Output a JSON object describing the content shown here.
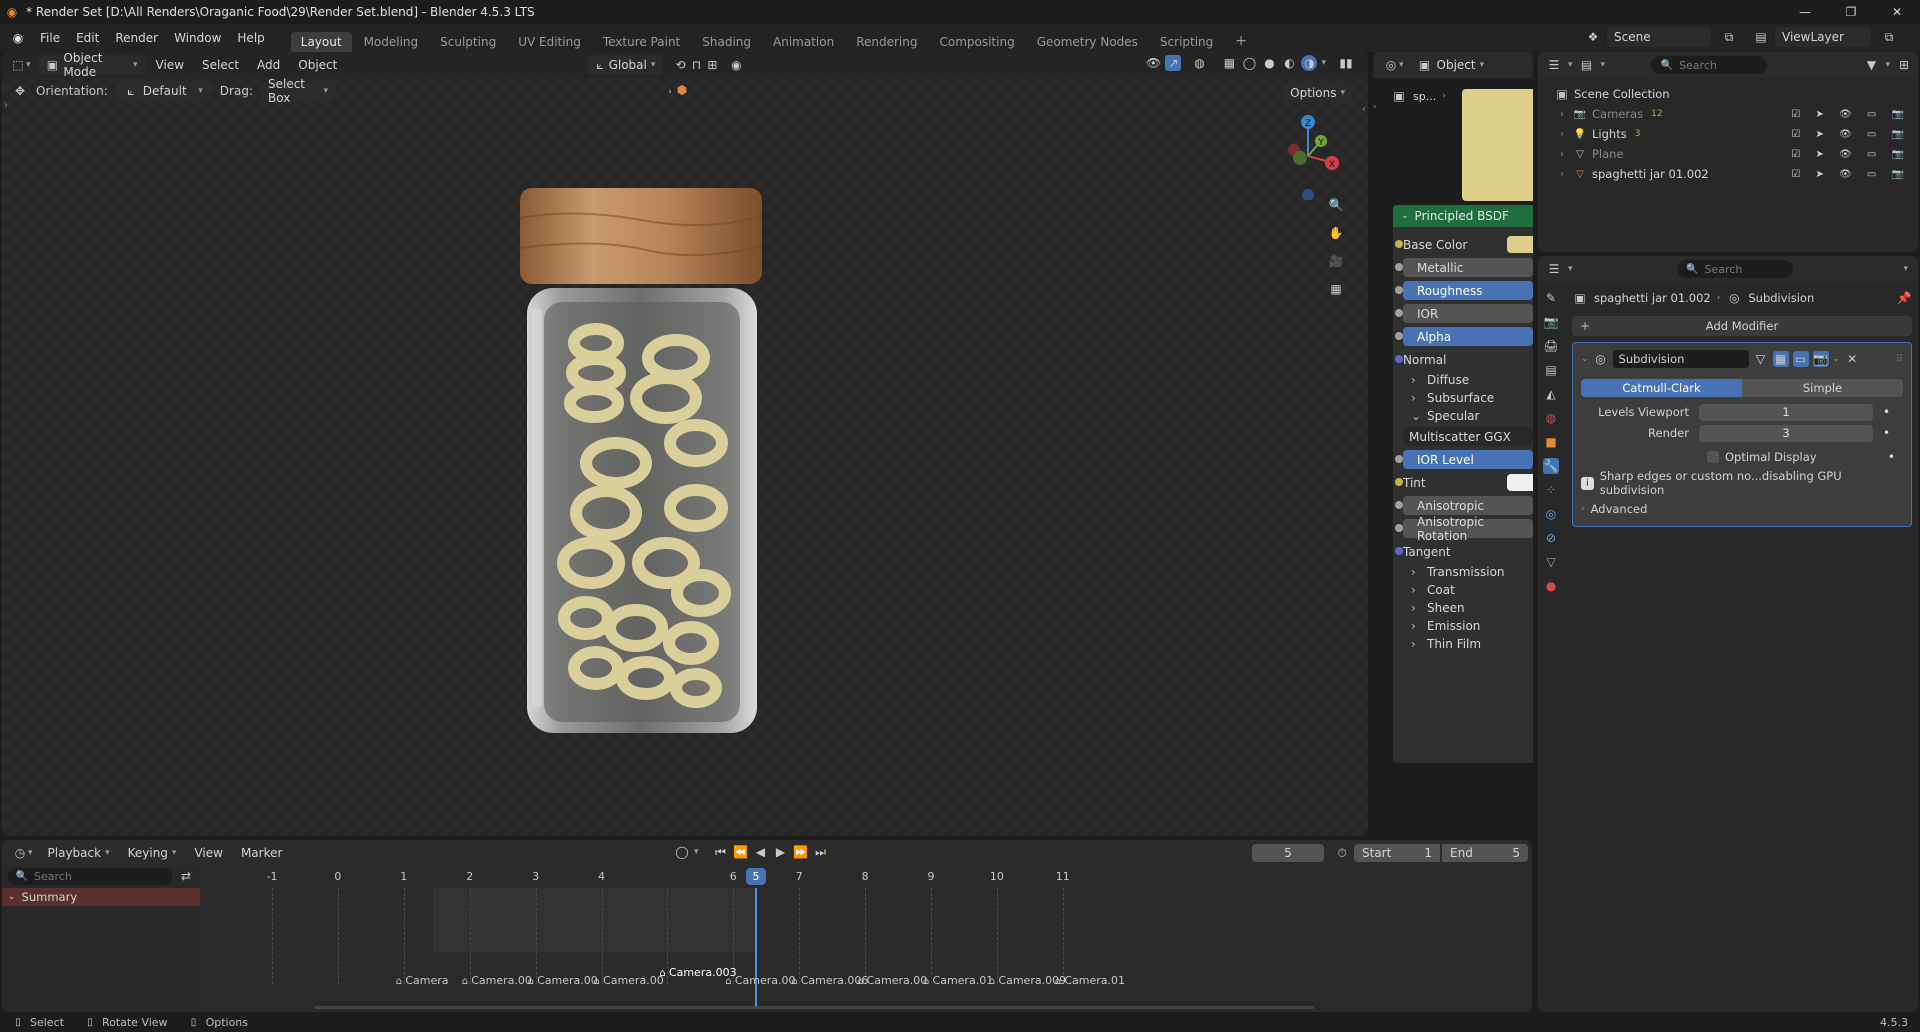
{
  "window": {
    "title": "* Render Set [D:\\All Renders\\Oraganic Food\\29\\Render Set.blend] - Blender 4.5.3 LTS",
    "controls": {
      "minimize": "—",
      "maximize": "❐",
      "close": "✕"
    }
  },
  "menu": {
    "items": [
      "File",
      "Edit",
      "Render",
      "Window",
      "Help"
    ]
  },
  "workspaces": {
    "tabs": [
      "Layout",
      "Modeling",
      "Sculpting",
      "UV Editing",
      "Texture Paint",
      "Shading",
      "Animation",
      "Rendering",
      "Compositing",
      "Geometry Nodes",
      "Scripting"
    ],
    "active": "Layout",
    "add": "+"
  },
  "scene": {
    "label": "Scene",
    "view_layer": "ViewLayer"
  },
  "viewport": {
    "mode": "Object Mode",
    "menus": [
      "View",
      "Select",
      "Add",
      "Object"
    ],
    "transform": "Global",
    "orientation_label": "Orientation:",
    "orientation": "Default",
    "drag_label": "Drag:",
    "drag": "Select Box",
    "options": "Options",
    "gizmo": {
      "z": "Z",
      "y": "Y",
      "x": "X"
    }
  },
  "shader_editor": {
    "object_menu": "Object",
    "breadcrumb": "sp...",
    "node_title": "Principled BSDF",
    "rows": [
      {
        "label": "Base Color",
        "type": "color",
        "socket": "#c7b54a",
        "swatch": "#e0cf8a"
      },
      {
        "label": "Metallic",
        "type": "field",
        "socket": "#a0a0a0",
        "blue": false
      },
      {
        "label": "Roughness",
        "type": "field",
        "socket": "#a0a0a0",
        "blue": true
      },
      {
        "label": "IOR",
        "type": "field",
        "socket": "#a0a0a0",
        "blue": false
      },
      {
        "label": "Alpha",
        "type": "field",
        "socket": "#a0a0a0",
        "blue": true
      },
      {
        "label": "Normal",
        "type": "text",
        "socket": "#6363c7"
      },
      {
        "label": "Diffuse",
        "type": "panel"
      },
      {
        "label": "Subsurface",
        "type": "panel"
      },
      {
        "label": "Specular",
        "type": "panel-open"
      },
      {
        "label": "Multiscatter GGX",
        "type": "dropdown"
      },
      {
        "label": "IOR Level",
        "type": "field",
        "socket": "#a0a0a0",
        "blue": true
      },
      {
        "label": "Tint",
        "type": "color",
        "socket": "#c7b54a",
        "swatch": "#f0f0f0"
      },
      {
        "label": "Anisotropic",
        "type": "field",
        "socket": "#a0a0a0",
        "blue": false
      },
      {
        "label": "Anisotropic Rotation",
        "type": "field",
        "socket": "#a0a0a0",
        "blue": false
      },
      {
        "label": "Tangent",
        "type": "text",
        "socket": "#6363c7"
      },
      {
        "label": "Transmission",
        "type": "panel"
      },
      {
        "label": "Coat",
        "type": "panel"
      },
      {
        "label": "Sheen",
        "type": "panel"
      },
      {
        "label": "Emission",
        "type": "panel"
      },
      {
        "label": "Thin Film",
        "type": "panel"
      }
    ]
  },
  "outliner": {
    "search_placeholder": "Search",
    "root": "Scene Collection",
    "items": [
      {
        "name": "Cameras",
        "badge": "12",
        "dim": true
      },
      {
        "name": "Lights",
        "badge": "3",
        "dim": false
      },
      {
        "name": "Plane",
        "badge": "",
        "dim": true
      },
      {
        "name": "spaghetti jar 01.002",
        "badge": "",
        "dim": false
      }
    ]
  },
  "properties": {
    "search_placeholder": "Search",
    "object": "spaghetti jar 01.002",
    "modifier_crumb": "Subdivision",
    "add_modifier": "Add Modifier",
    "modifier_name": "Subdivision",
    "method": {
      "options": [
        "Catmull-Clark",
        "Simple"
      ],
      "active": "Catmull-Clark"
    },
    "levels_viewport_label": "Levels Viewport",
    "levels_viewport": "1",
    "render_label": "Render",
    "render": "3",
    "optimal_display": "Optimal Display",
    "warning": "Sharp edges or custom no...disabling GPU subdivision",
    "advanced": "Advanced"
  },
  "timeline": {
    "menus": [
      "Playback",
      "Keying",
      "View",
      "Marker"
    ],
    "current_frame": "5",
    "start_label": "Start",
    "start": "1",
    "end_label": "End",
    "end": "5",
    "search_placeholder": "Search",
    "summary": "Summary",
    "frames": [
      "-1",
      "0",
      "1",
      "2",
      "3",
      "4",
      "5",
      "6",
      "7",
      "8",
      "9",
      "10",
      "11"
    ],
    "markers": [
      "Camera",
      "Camera.00",
      "Camera.00",
      "Camera.00",
      "Camera.003",
      "Camera.00",
      "Camera.006",
      "Camera.00",
      "Camera.01",
      "Camera.009",
      "Camera.01"
    ]
  },
  "statusbar": {
    "select": "Select",
    "rotate": "Rotate View",
    "options": "Options",
    "version": "4.5.3"
  }
}
